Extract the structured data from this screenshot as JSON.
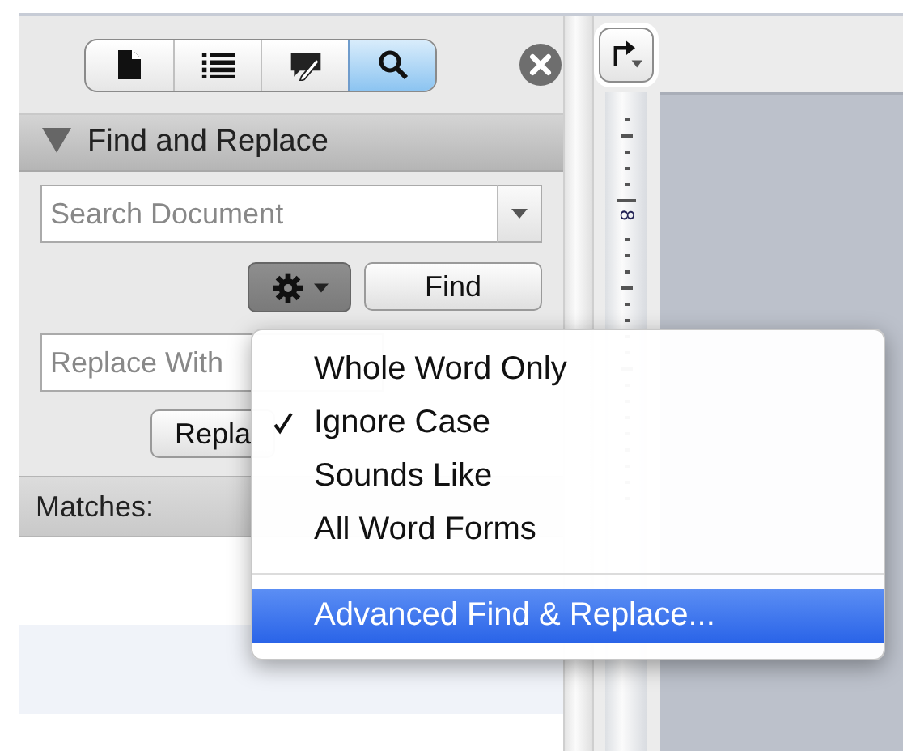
{
  "toolbar": {
    "segments": [
      {
        "kind": "page",
        "selected": false
      },
      {
        "kind": "list",
        "selected": false
      },
      {
        "kind": "note",
        "selected": false
      },
      {
        "kind": "search",
        "selected": true
      }
    ]
  },
  "panel": {
    "title": "Find and Replace",
    "expanded": true
  },
  "search_field": {
    "placeholder": "Search Document"
  },
  "find_button": "Find",
  "replace_field": {
    "placeholder": "Replace With"
  },
  "replace_button": "Repla",
  "matches_label": "Matches:",
  "ruler": {
    "labels": [
      "8"
    ]
  },
  "menu": {
    "items": [
      {
        "kind": "option",
        "label": "Whole Word Only",
        "checked": false,
        "selected": false
      },
      {
        "kind": "option",
        "label": "Ignore Case",
        "checked": true,
        "selected": false
      },
      {
        "kind": "option",
        "label": "Sounds Like",
        "checked": false,
        "selected": false
      },
      {
        "kind": "option",
        "label": "All Word Forms",
        "checked": false,
        "selected": false
      },
      {
        "kind": "separator"
      },
      {
        "kind": "option",
        "label": "Advanced Find & Replace...",
        "checked": false,
        "selected": true
      }
    ]
  }
}
